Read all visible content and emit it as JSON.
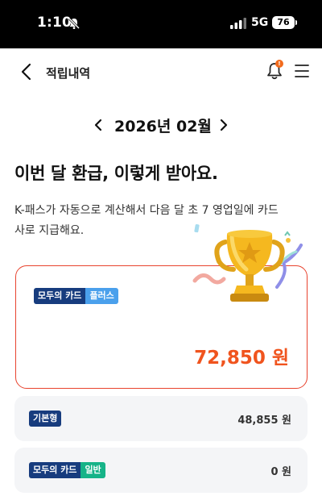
{
  "status_bar": {
    "time": "1:10",
    "network": "5G",
    "battery": "76"
  },
  "nav": {
    "title": "적립내역",
    "notification_badge": "!"
  },
  "month": {
    "label": "2026년 02월"
  },
  "headline": "이번 달 환급, 이렇게 받아요.",
  "description": "K-패스가 자동으로 계산해서 다음 달 초 7 영업일에 카드사로 지급해요.",
  "main_card": {
    "tag_primary": "모두의 카드",
    "tag_secondary": "플러스",
    "amount": "72,850 원"
  },
  "rows": [
    {
      "tag_primary": "기본형",
      "amount": "48,855 원"
    },
    {
      "tag_primary": "모두의 카드",
      "tag_secondary": "일반",
      "amount": "0 원"
    }
  ],
  "colors": {
    "accent": "#f0541e",
    "card_border": "#e8432e",
    "tag_dark": "#173c7e",
    "tag_blue": "#4aa0ec",
    "tag_green": "#16b388"
  }
}
